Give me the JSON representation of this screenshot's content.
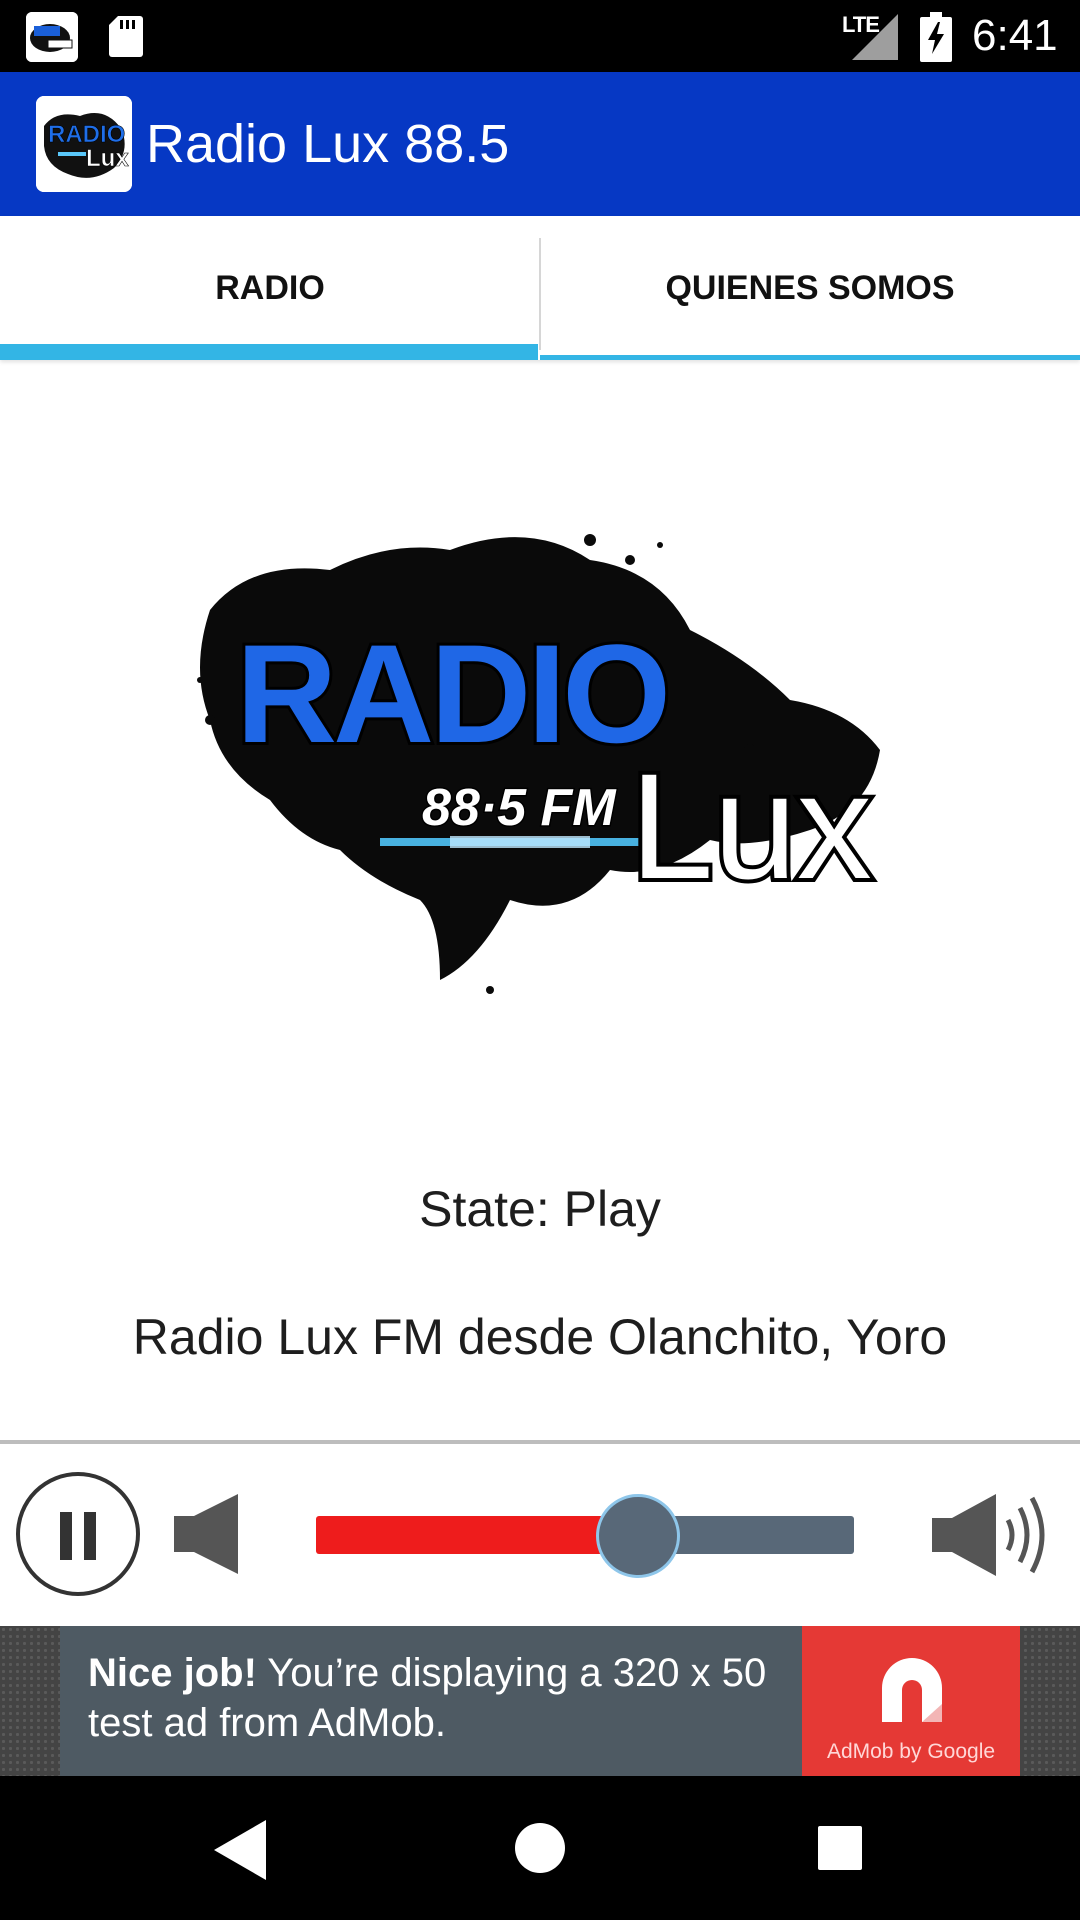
{
  "status_bar": {
    "network": "LTE",
    "time": "6:41",
    "icons": [
      "radio-lux-app-icon",
      "sd-card-icon",
      "signal-icon",
      "battery-charging-icon"
    ]
  },
  "app_bar": {
    "title": "Radio Lux 88.5",
    "color": "#0638c4",
    "logo_icon": "radio-lux-logo-icon"
  },
  "tabs": [
    {
      "label": "RADIO",
      "selected": true
    },
    {
      "label": "QUIENES SOMOS",
      "selected": false
    }
  ],
  "tab_indicator_color": "#33b5e5",
  "station_logo": {
    "word_top": "RADIO",
    "frequency": "88·5 FM",
    "word_bottom": "Lux"
  },
  "player": {
    "state_text": "State: Play",
    "description": "Radio Lux FM desde Olanchito, Yoro",
    "pause_icon": "pause-icon",
    "volume_low_icon": "volume-low-icon",
    "volume_high_icon": "volume-high-icon",
    "volume_level": 0.55,
    "volume_fill_color": "#ee1c1c",
    "volume_track_color": "#586878"
  },
  "ad": {
    "headline": "Nice job!",
    "body": " You’re displaying a 320 x 50 test ad from AdMob.",
    "badge_caption": "AdMob by Google",
    "badge_color": "#e53935"
  },
  "nav_bar": {
    "icons": [
      "back-icon",
      "home-icon",
      "recents-icon"
    ]
  }
}
